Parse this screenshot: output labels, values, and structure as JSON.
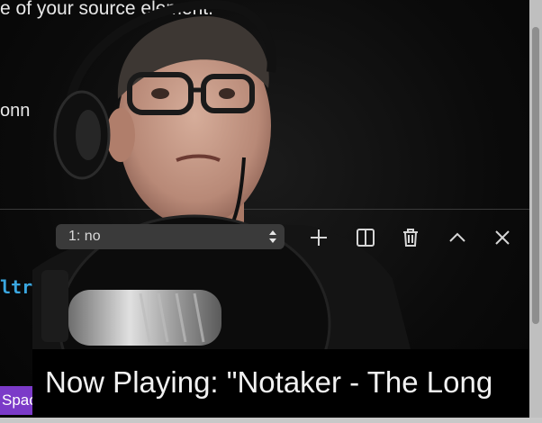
{
  "editor": {
    "top_text": "e of your source element.",
    "left_text": "onn",
    "code_fragment": "ltr",
    "space_badge": "Spac"
  },
  "terminal": {
    "selected_terminal": "1: no",
    "toolbar_icons": [
      "plus-icon",
      "split-icon",
      "trash-icon",
      "chevron-up-icon",
      "close-icon"
    ]
  },
  "overlay": {
    "now_playing": "Now Playing: \"Notaker - The Long"
  },
  "colors": {
    "badge": "#7b3ac8",
    "code_accent": "#3aa7e0"
  }
}
